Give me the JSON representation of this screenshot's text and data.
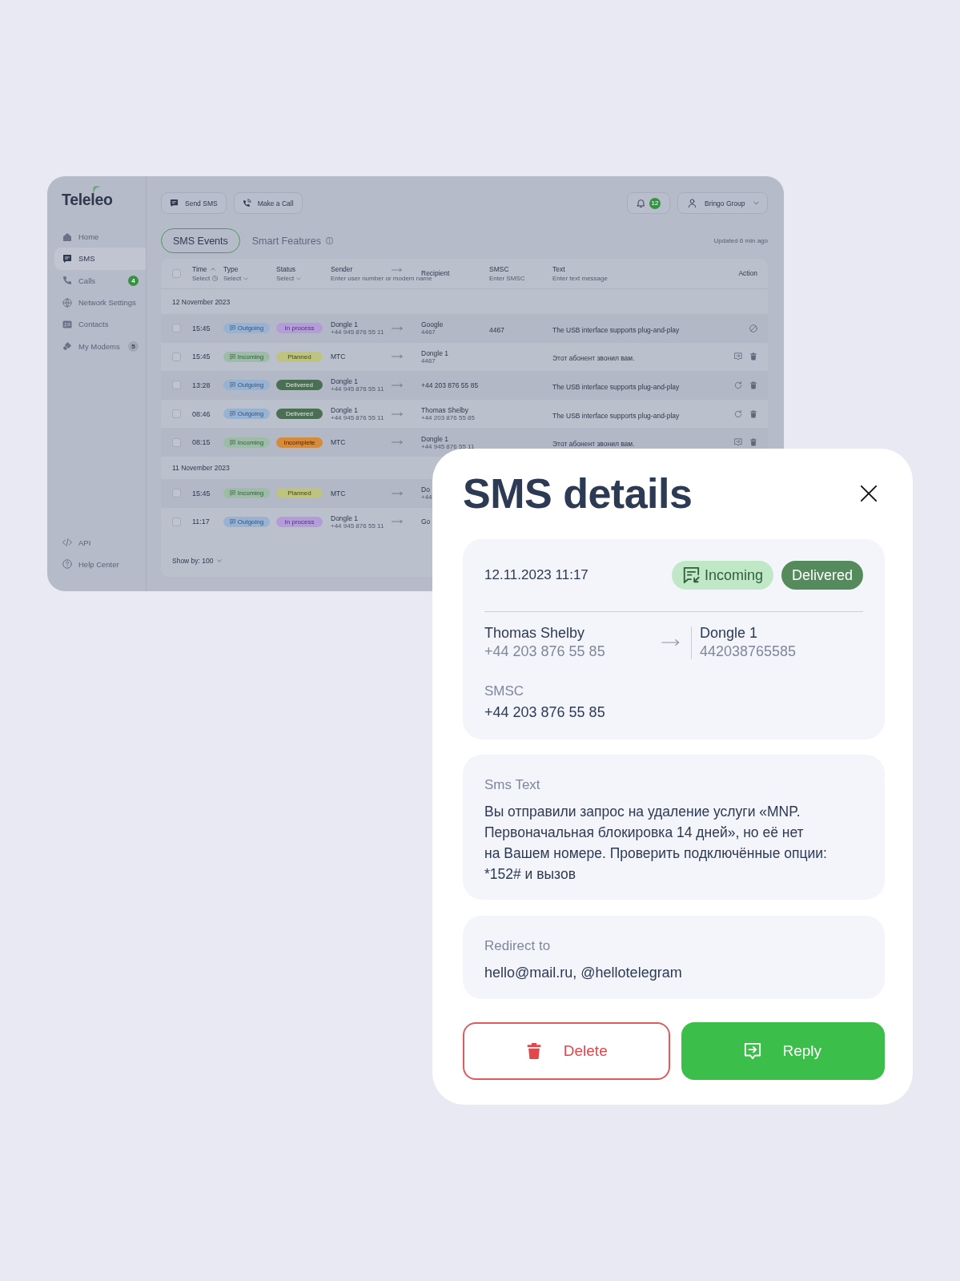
{
  "app": {
    "logo": "Teleleo",
    "nav": [
      {
        "label": "Home",
        "selected": false
      },
      {
        "label": "SMS",
        "selected": true
      },
      {
        "label": "Calls",
        "selected": false,
        "badge": {
          "text": "4",
          "kind": "accent"
        }
      },
      {
        "label": "Network Settings",
        "selected": false
      },
      {
        "label": "Contacts",
        "selected": false
      },
      {
        "label": "My Modems",
        "selected": false,
        "badge": {
          "text": "5",
          "kind": "muted"
        }
      }
    ],
    "nav_bottom": [
      {
        "label": "API"
      },
      {
        "label": "Help Center"
      }
    ],
    "toolbar": {
      "actions": [
        {
          "label": "Send SMS"
        },
        {
          "label": "Make a Call"
        }
      ],
      "notifications": {
        "count": "12"
      },
      "account": {
        "label": "Bringo Group"
      }
    },
    "tabs": [
      {
        "label": "SMS Events",
        "selected": true,
        "info": false
      },
      {
        "label": "Smart Features",
        "selected": false,
        "info": true
      }
    ],
    "updated": "Updated 6 min ago",
    "table": {
      "select_all": {
        "checked": false
      },
      "columns": [
        {
          "label": "Time",
          "ascending": true,
          "filter": {
            "kind": "time",
            "placeholder": "Select"
          }
        },
        {
          "label": "Type",
          "filter": {
            "kind": "select",
            "placeholder": "Select"
          }
        },
        {
          "label": "Status",
          "filter": {
            "kind": "select",
            "placeholder": "Select"
          }
        },
        {
          "label": "Sender",
          "filter": {
            "kind": "text",
            "placeholder": "Enter user number or modem name"
          }
        },
        {
          "label": "Recipient"
        },
        {
          "label": "SMSC",
          "filter": {
            "kind": "text",
            "placeholder": "Enter SMSC"
          }
        },
        {
          "label": "Text",
          "filter": {
            "kind": "text",
            "placeholder": "Enter text message"
          }
        },
        {
          "label": "Action"
        }
      ],
      "groups": [
        {
          "date": "12 November 2023",
          "rows": [
            {
              "checked": false,
              "time": "15:45",
              "type": {
                "label": "Outgoing",
                "kind": "outgoing"
              },
              "status": {
                "label": "In process",
                "kind": "in_process"
              },
              "sender": {
                "name": "Dongle 1",
                "number": "+44 945 876 55 11"
              },
              "recipient": {
                "name": "Google",
                "number": "4467"
              },
              "smsc": "4467",
              "text": "The USB interface supports plug-and-play",
              "actions": [
                {
                  "kind": "cancel"
                }
              ]
            },
            {
              "checked": false,
              "time": "15:45",
              "type": {
                "label": "Incoming",
                "kind": "incoming"
              },
              "status": {
                "label": "Planned",
                "kind": "planned"
              },
              "sender": {
                "name": "MTC"
              },
              "recipient": {
                "name": "Dongle 1",
                "number": "4467"
              },
              "text": "Этот абонент звонил вам.",
              "actions": [
                {
                  "kind": "reply"
                },
                {
                  "kind": "delete"
                }
              ]
            },
            {
              "checked": false,
              "time": "13:28",
              "type": {
                "label": "Outgoing",
                "kind": "outgoing"
              },
              "status": {
                "label": "Delivered",
                "kind": "delivered"
              },
              "sender": {
                "name": "Dongle 1",
                "number": "+44 945 876 55 11"
              },
              "recipient": {
                "name": "+44 203 876 55 85"
              },
              "text": "The USB interface supports plug-and-play",
              "actions": [
                {
                  "kind": "retry"
                },
                {
                  "kind": "delete"
                }
              ]
            },
            {
              "checked": false,
              "time": "08:46",
              "type": {
                "label": "Outgoing",
                "kind": "outgoing"
              },
              "status": {
                "label": "Delivered",
                "kind": "delivered"
              },
              "sender": {
                "name": "Dongle 1",
                "number": "+44 945 876 55 11"
              },
              "recipient": {
                "name": "Thomas Shelby",
                "number": "+44 203 876 55 85"
              },
              "text": "The USB interface supports plug-and-play",
              "actions": [
                {
                  "kind": "retry"
                },
                {
                  "kind": "delete"
                }
              ]
            },
            {
              "checked": false,
              "time": "08:15",
              "type": {
                "label": "Incoming",
                "kind": "incoming"
              },
              "status": {
                "label": "Incomplete",
                "kind": "incomplete"
              },
              "sender": {
                "name": "MTC"
              },
              "recipient": {
                "name": "Dongle 1",
                "number": "+44 945 876 55 11"
              },
              "text": "Этот абонент звонил вам.",
              "actions": [
                {
                  "kind": "reply"
                },
                {
                  "kind": "delete"
                }
              ]
            }
          ]
        },
        {
          "date": "11 November 2023",
          "rows": [
            {
              "checked": false,
              "time": "15:45",
              "type": {
                "label": "Incoming",
                "kind": "incoming"
              },
              "status": {
                "label": "Planned",
                "kind": "planned"
              },
              "sender": {
                "name": "MTC"
              },
              "recipient": {
                "name": "Do",
                "number": "+44"
              }
            },
            {
              "checked": false,
              "time": "11:17",
              "type": {
                "label": "Outgoing",
                "kind": "outgoing"
              },
              "status": {
                "label": "In process",
                "kind": "in_process"
              },
              "sender": {
                "name": "Dongle 1",
                "number": "+44 945 876 55 11"
              },
              "recipient": {
                "name": "Go"
              }
            }
          ]
        }
      ],
      "footer": {
        "page_size": "Show by: 100"
      }
    }
  },
  "dialog": {
    "title": "SMS details",
    "datetime": "12.11.2023 11:17",
    "type": {
      "label": "Incoming",
      "kind": "incoming"
    },
    "status": {
      "label": "Delivered",
      "kind": "delivered"
    },
    "sender": {
      "name": "Thomas Shelby",
      "number": "+44 203 876 55 85"
    },
    "recipient": {
      "name": "Dongle 1",
      "number": "442038765585"
    },
    "smsc": {
      "label": "SMSC",
      "value": "+44 203 876 55 85"
    },
    "message": {
      "label": "Sms Text",
      "value": "Вы отправили запрос на удаление услуги «MNP.\nПервоначальная блокировка 14 дней», но её нет\nна Вашем номере. Проверить подключённые опции:\n*152# и вызов"
    },
    "redirect": {
      "label": "Redirect to",
      "value": "hello@mail.ru, @hellotelegram"
    },
    "buttons": [
      {
        "label": "Delete",
        "kind": "delete"
      },
      {
        "label": "Reply",
        "kind": "reply"
      }
    ]
  }
}
